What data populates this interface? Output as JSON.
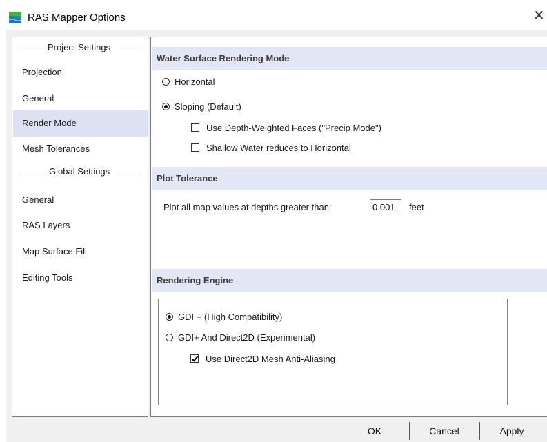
{
  "window": {
    "title": "RAS Mapper Options",
    "close_glyph": "✕",
    "icon": "ras-mapper-app-icon"
  },
  "nav": {
    "project_header": "Project Settings",
    "project_items": [
      {
        "label": "Projection",
        "selected": false
      },
      {
        "label": "General",
        "selected": false
      },
      {
        "label": "Render Mode",
        "selected": true
      },
      {
        "label": "Mesh Tolerances",
        "selected": false
      }
    ],
    "global_header": "Global Settings",
    "global_items": [
      {
        "label": "General",
        "selected": false
      },
      {
        "label": "RAS Layers",
        "selected": false
      },
      {
        "label": "Map Surface Fill",
        "selected": false
      },
      {
        "label": "Editing Tools",
        "selected": false
      }
    ]
  },
  "water_surface": {
    "header": "Water Surface Rendering Mode",
    "horizontal_label": "Horizontal",
    "horizontal_selected": false,
    "sloping_label": "Sloping (Default)",
    "sloping_selected": true,
    "depth_weighted_label": "Use Depth-Weighted Faces (\"Precip Mode\")",
    "depth_weighted_checked": false,
    "shallow_water_label": "Shallow Water reduces to Horizontal",
    "shallow_water_checked": false
  },
  "plot_tolerance": {
    "header": "Plot Tolerance",
    "prompt": "Plot all map values at depths greater than:",
    "value": "0.001",
    "unit": "feet"
  },
  "rendering_engine": {
    "header": "Rendering Engine",
    "gdi_label": "GDI + (High Compatibility)",
    "gdi_selected": true,
    "direct2d_label": "GDI+ And Direct2D (Experimental)",
    "direct2d_selected": false,
    "antialias_label": "Use Direct2D Mesh Anti-Aliasing",
    "antialias_checked": true
  },
  "buttons": {
    "ok": "OK",
    "cancel": "Cancel",
    "apply": "Apply"
  },
  "colors": {
    "selected_nav": "#dde1f3",
    "section_header": "#e3e6f4",
    "dialog_bg": "#f0f0f0"
  }
}
